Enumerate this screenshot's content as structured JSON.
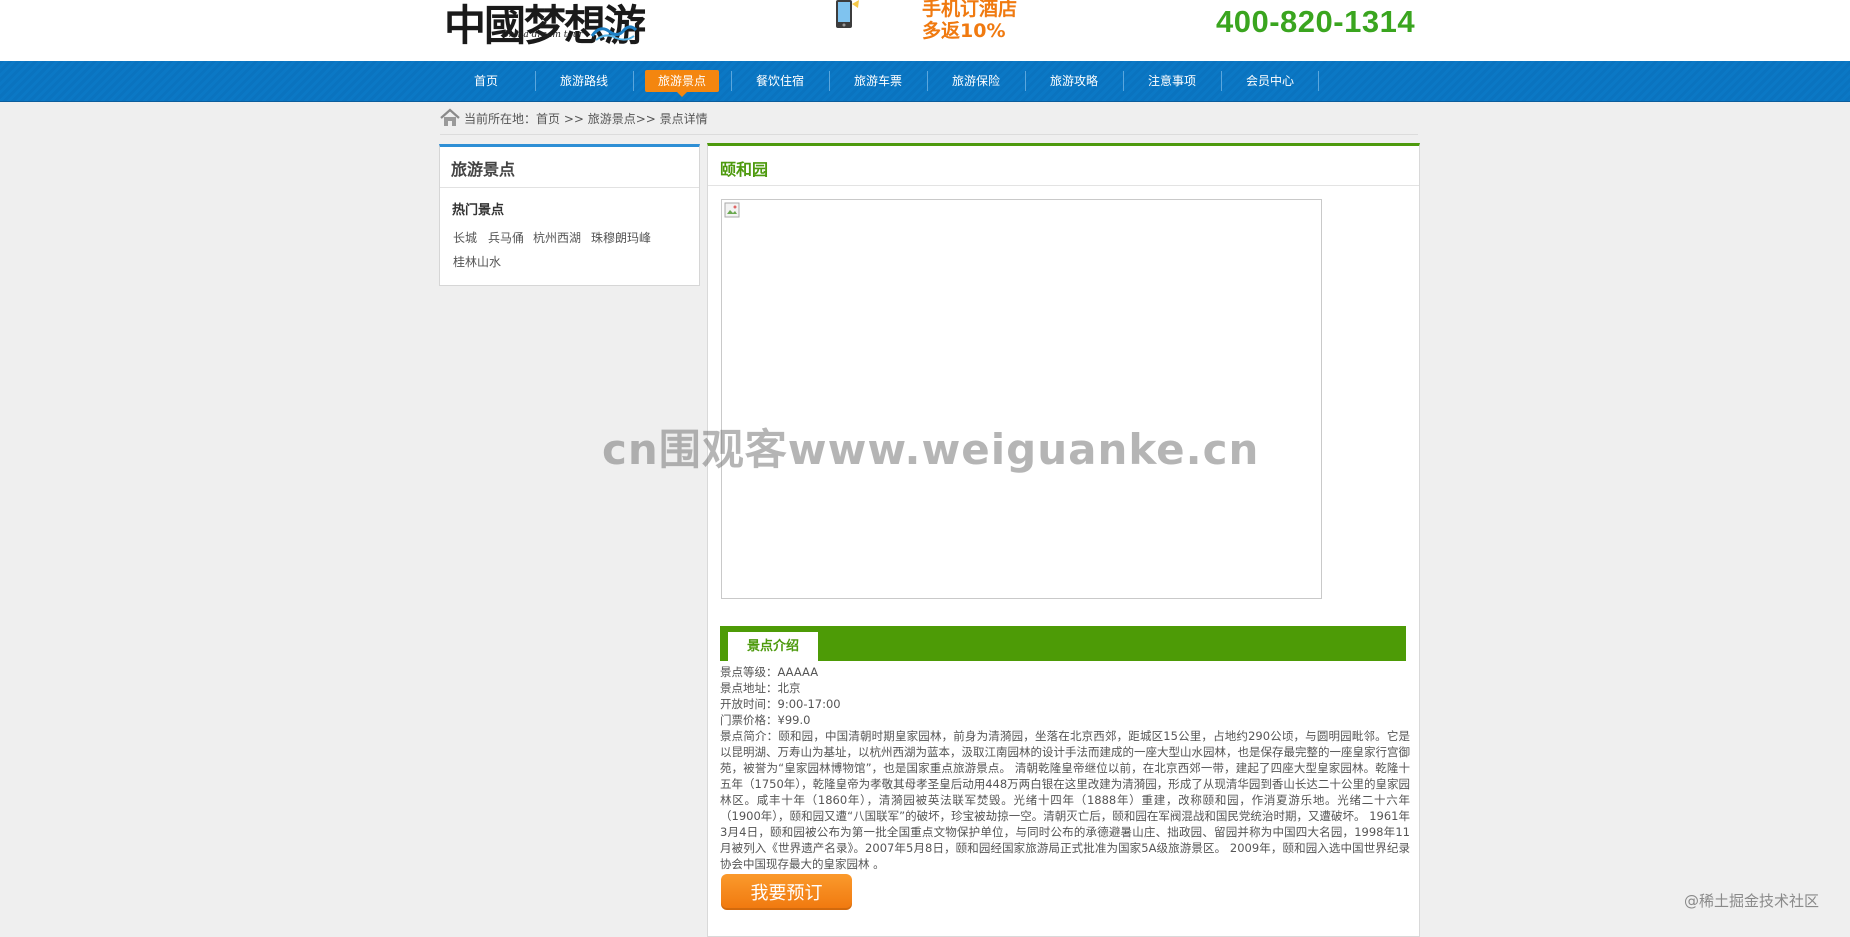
{
  "header": {
    "logo_cn_part1": "中國",
    "logo_cn_part2": "梦想游",
    "logo_en": "China dream tour",
    "promo_line1": "手机订酒店",
    "promo_line2": "多返10%",
    "hotline": "400-820-1314"
  },
  "nav": {
    "items": [
      {
        "label": "首页"
      },
      {
        "label": "旅游路线"
      },
      {
        "label": "旅游景点"
      },
      {
        "label": "餐饮住宿"
      },
      {
        "label": "旅游车票"
      },
      {
        "label": "旅游保险"
      },
      {
        "label": "旅游攻略"
      },
      {
        "label": "注意事项"
      },
      {
        "label": "会员中心"
      }
    ],
    "active_index": 2,
    "active_color": "#f4860f",
    "bar_color": "#0a73bf"
  },
  "breadcrumb": {
    "text": "当前所在地：首页 >> 旅游景点>> 景点详情"
  },
  "sidebar": {
    "title": "旅游景点",
    "hot_title": "热门景点",
    "links": [
      "长城",
      "兵马俑",
      "杭州西湖",
      "珠穆朗玛峰",
      "桂林山水"
    ]
  },
  "main": {
    "title": "颐和园",
    "intro_tab": "景点介绍",
    "level": "景点等级：AAAAA",
    "address": "景点地址：北京",
    "hours": "开放时间：9:00-17:00",
    "price": "门票价格：¥99.0",
    "description": "景点简介：颐和园，中国清朝时期皇家园林，前身为清漪园，坐落在北京西郊，距城区15公里，占地约290公顷，与圆明园毗邻。它是以昆明湖、万寿山为基址，以杭州西湖为蓝本，汲取江南园林的设计手法而建成的一座大型山水园林，也是保存最完整的一座皇家行宫御苑，被誉为“皇家园林博物馆”，也是国家重点旅游景点。 清朝乾隆皇帝继位以前，在北京西郊一带，建起了四座大型皇家园林。乾隆十五年（1750年），乾隆皇帝为孝敬其母孝圣皇后动用448万两白银在这里改建为清漪园，形成了从现清华园到香山长达二十公里的皇家园林区。咸丰十年（1860年），清漪园被英法联军焚毁。光绪十四年（1888年）重建，改称颐和园，作消夏游乐地。光绪二十六年（1900年），颐和园又遭“八国联军”的破坏，珍宝被劫掠一空。清朝灭亡后，颐和园在军阀混战和国民党统治时期，又遭破坏。 1961年3月4日，颐和园被公布为第一批全国重点文物保护单位，与同时公布的承德避暑山庄、拙政园、留园并称为中国四大名园，1998年11月被列入《世界遗产名录》。2007年5月8日，颐和园经国家旅游局正式批准为国家5A级旅游景区。 2009年，颐和园入选中国世界纪录协会中国现存最大的皇家园林 。",
    "book_label": "我要预订",
    "accent_color": "#4d9a0d"
  },
  "watermark": "cn围观客www.weiguanke.cn",
  "credit": "@稀土掘金技术社区"
}
